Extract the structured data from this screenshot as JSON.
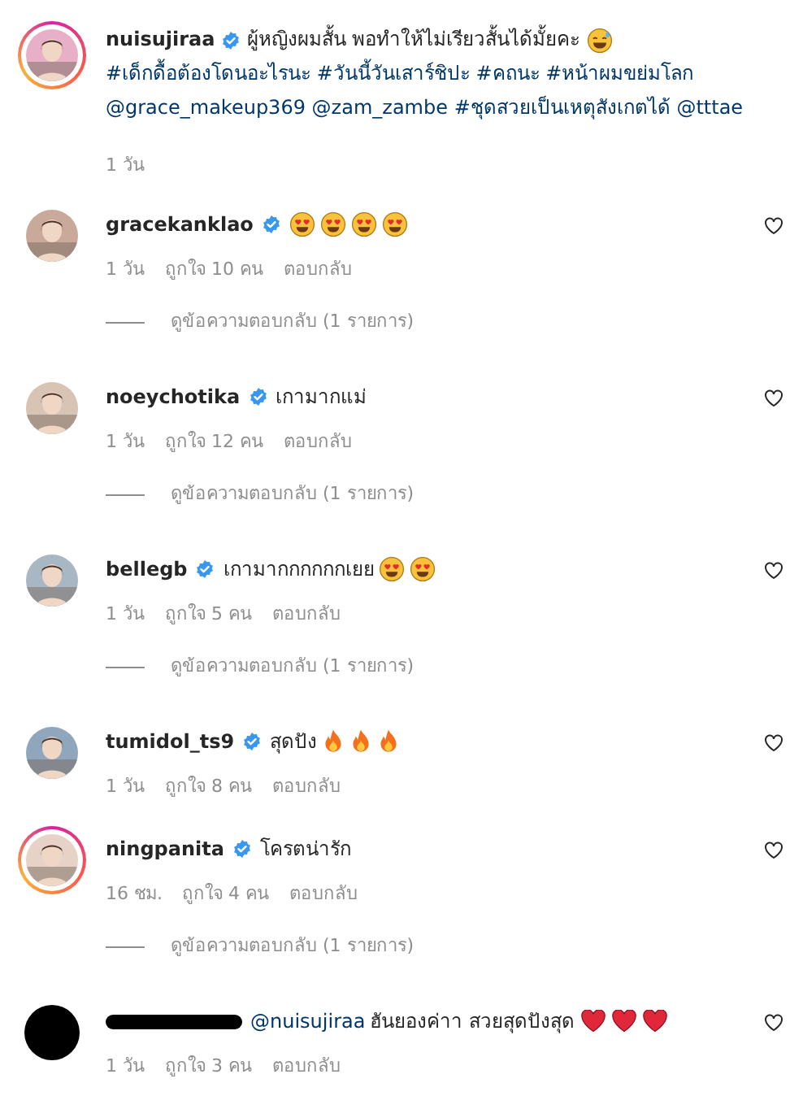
{
  "caption": {
    "username": "nuisujiraa",
    "verified": true,
    "story_ring": true,
    "segments": [
      {
        "kind": "plain",
        "text": "ผู้หญิงผมสั้น พอทำให้ไม่เรียวสั้นได้มั้ยคะ"
      },
      {
        "kind": "sweat_smile"
      },
      {
        "kind": "link",
        "text": "#เด็กดื้อต้องโดนอะไรนะ"
      },
      {
        "kind": "link",
        "text": "#วันนี้วันเสาร์ชิปะ"
      },
      {
        "kind": "link",
        "text": "#คถนะ"
      },
      {
        "kind": "link",
        "text": "#หน้าผมขย่มโลก"
      },
      {
        "kind": "link",
        "text": "@grace_makeup369"
      },
      {
        "kind": "link",
        "text": "@zam_zambe"
      },
      {
        "kind": "link",
        "text": "#ชุดสวยเป็นเหตุสังเกตได้"
      },
      {
        "kind": "link",
        "text": "@tttae"
      }
    ],
    "time": "1 วัน"
  },
  "comments": [
    {
      "username": "gracekanklao",
      "verified": true,
      "story_ring": false,
      "segments": [
        {
          "kind": "heart_eyes"
        },
        {
          "kind": "heart_eyes"
        },
        {
          "kind": "heart_eyes"
        },
        {
          "kind": "heart_eyes"
        }
      ],
      "time": "1 วัน",
      "likes": "ถูกใจ 10 คน",
      "reply": "ตอบกลับ",
      "view_replies": "ดูข้อความตอบกลับ (1 รายการ)"
    },
    {
      "username": "noeychotika",
      "verified": true,
      "story_ring": false,
      "segments": [
        {
          "kind": "plain",
          "text": "เกามากแม่"
        }
      ],
      "time": "1 วัน",
      "likes": "ถูกใจ 12 คน",
      "reply": "ตอบกลับ",
      "view_replies": "ดูข้อความตอบกลับ (1 รายการ)"
    },
    {
      "username": "bellegb",
      "verified": true,
      "story_ring": false,
      "segments": [
        {
          "kind": "plain",
          "text": "เกามากกกกกกเยย"
        },
        {
          "kind": "heart_eyes"
        },
        {
          "kind": "heart_eyes"
        }
      ],
      "time": "1 วัน",
      "likes": "ถูกใจ 5 คน",
      "reply": "ตอบกลับ",
      "view_replies": "ดูข้อความตอบกลับ (1 รายการ)"
    },
    {
      "username": "tumidol_ts9",
      "verified": true,
      "story_ring": false,
      "segments": [
        {
          "kind": "plain",
          "text": "สุดปัง"
        },
        {
          "kind": "fire"
        },
        {
          "kind": "fire"
        },
        {
          "kind": "fire"
        }
      ],
      "time": "1 วัน",
      "likes": "ถูกใจ 8 คน",
      "reply": "ตอบกลับ"
    },
    {
      "username": "ningpanita",
      "verified": true,
      "story_ring": true,
      "segments": [
        {
          "kind": "plain",
          "text": "โครตน่ารัก"
        }
      ],
      "time": "16 ชม.",
      "likes": "ถูกใจ 4 คน",
      "reply": "ตอบกลับ",
      "view_replies": "ดูข้อความตอบกลับ (1 รายการ)"
    },
    {
      "redacted": true,
      "verified": false,
      "story_ring": false,
      "segments": [
        {
          "kind": "link",
          "text": "@nuisujiraa"
        },
        {
          "kind": "plain",
          "text": "ฮันยองค่าา สวยสุดปังสุด"
        },
        {
          "kind": "heart"
        },
        {
          "kind": "heart"
        },
        {
          "kind": "heart"
        }
      ],
      "time": "1 วัน",
      "likes": "ถูกใจ 3 คน",
      "reply": "ตอบกลับ"
    }
  ]
}
